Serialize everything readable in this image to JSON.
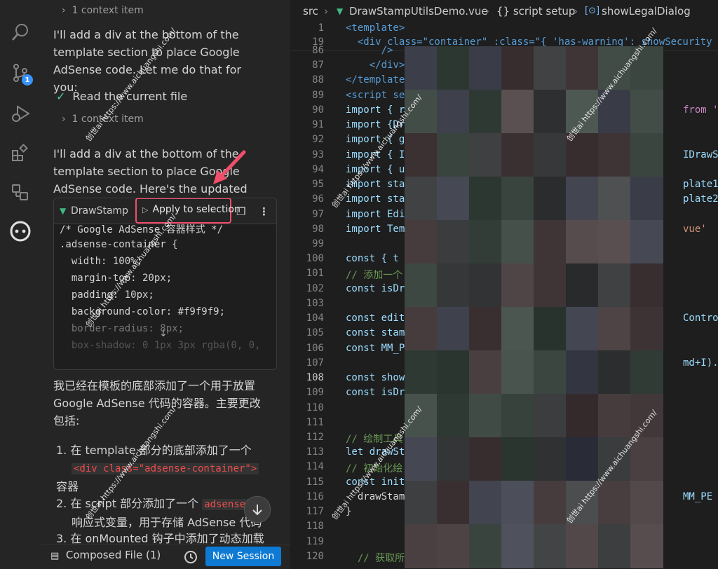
{
  "chat": {
    "context_item_1": "1 context item",
    "para_1": "I'll add a div at the bottom of the template section to place Google AdSense code. Let me do that for you:",
    "read_file": "Read the current file",
    "context_item_2": "1 context item",
    "para_2": "I'll add a div at the bottom of the template section to place Google AdSense code. Here's the updated file:",
    "code_card": {
      "filename": "DrawStamp",
      "apply_label": "Apply to selection",
      "lines": [
        "/* Google AdSense 容器样式 */",
        ".adsense-container {",
        "  width: 100%;",
        "  margin-top: 20px;",
        "  padding: 10px;",
        "  background-color: #f9f9f9;",
        "  border-radius: 8px;",
        "  box-shadow: 0 1px 3px rgba(0, 0,"
      ]
    },
    "summary": "我已经在模板的底部添加了一个用于放置 Google AdSense 代码的容器。主要更改包括:",
    "item_1_num": "1.",
    "item_1_pre": "在 template 部分的底部添加了一个",
    "item_1_code": "<div class=\"adsense-container\">",
    "item_1_post": "容器",
    "item_2_num": "2.",
    "item_2_pre": "在 script 部分添加了一个",
    "item_2_code": "adsenseC",
    "item_2_post": "响应式变量，用于存储 AdSense 代码",
    "item_3_num": "3.",
    "item_3_pre": "在 onMounted 钩子中添加了动态加载",
    "composed_file": "Composed File (1)",
    "new_session": "New Session"
  },
  "breadcrumb": {
    "src": "src",
    "file": "DrawStampUtilsDemo.vue",
    "section": "{} script setup",
    "symbol": "showLegalDialog"
  },
  "editor": {
    "sticky": [
      {
        "ln": "1",
        "code": "<template>"
      },
      {
        "ln": "19",
        "code": "  <div class=\"container\" :class=\"{ 'has-warning': showSecurity"
      }
    ],
    "lines": [
      {
        "ln": "86",
        "code": "      />"
      },
      {
        "ln": "87",
        "code": "    </div>"
      },
      {
        "ln": "88",
        "code": "</template>"
      },
      {
        "ln": "89",
        "code": "<script se"
      },
      {
        "ln": "90",
        "code": "import { r"
      },
      {
        "ln": "91",
        "code": "import {Dr"
      },
      {
        "ln": "92",
        "code": "import { g"
      },
      {
        "ln": "93",
        "code": "import { I"
      },
      {
        "ln": "94",
        "code": "import { u"
      },
      {
        "ln": "95",
        "code": "import sta"
      },
      {
        "ln": "96",
        "code": "import sta"
      },
      {
        "ln": "97",
        "code": "import Edi"
      },
      {
        "ln": "98",
        "code": "import Tem"
      },
      {
        "ln": "99",
        "code": ""
      },
      {
        "ln": "100",
        "code": "const { t"
      },
      {
        "ln": "101",
        "code": "// 添加一个"
      },
      {
        "ln": "102",
        "code": "const isDr"
      },
      {
        "ln": "103",
        "code": ""
      },
      {
        "ln": "104",
        "code": "const edit"
      },
      {
        "ln": "105",
        "code": "const stam"
      },
      {
        "ln": "106",
        "code": "const MM_P"
      },
      {
        "ln": "107",
        "code": ""
      },
      {
        "ln": "108",
        "code": "const show"
      },
      {
        "ln": "109",
        "code": "const isDr"
      },
      {
        "ln": "110",
        "code": ""
      },
      {
        "ln": "111",
        "code": ""
      },
      {
        "ln": "112",
        "code": "// 绘制工具"
      },
      {
        "ln": "113",
        "code": "let drawSt"
      },
      {
        "ln": "114",
        "code": "// 初始化绘"
      },
      {
        "ln": "115",
        "code": "const init"
      },
      {
        "ln": "116",
        "code": "  drawStamp"
      },
      {
        "ln": "117",
        "code": "}"
      },
      {
        "ln": "118",
        "code": ""
      },
      {
        "ln": "119",
        "code": ""
      },
      {
        "ln": "120",
        "code": "  // 获取所有文字路径（包括目录、编号和印章文字）"
      }
    ],
    "right_fragments": [
      {
        "ln": "90",
        "text": "from '"
      },
      {
        "ln": "93",
        "text": "IDrawS"
      },
      {
        "ln": "95",
        "text": "plate1"
      },
      {
        "ln": "96",
        "text": "plate2"
      },
      {
        "ln": "98",
        "text": "vue'"
      },
      {
        "ln": "104",
        "text": "Contro"
      },
      {
        "ln": "107",
        "text": "md+I)."
      },
      {
        "ln": "116",
        "text": "MM_PE"
      }
    ]
  },
  "watermark": {
    "brand": "创世ai",
    "url": "https://www.aichuangshi.com/"
  },
  "colors": {
    "accent": "#0e7ad4",
    "highlight_box": "#f04e6a",
    "badge": "#3794ff"
  }
}
